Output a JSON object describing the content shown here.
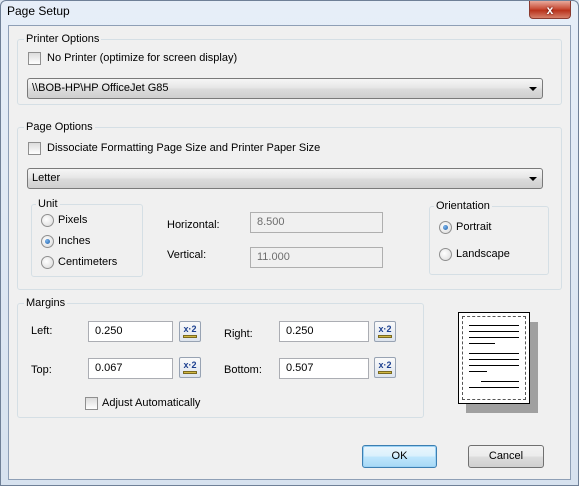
{
  "window": {
    "title": "Page Setup"
  },
  "printer_options": {
    "legend": "Printer Options",
    "no_printer_label": "No Printer (optimize for screen display)",
    "no_printer_checked": false,
    "printer_selected": "\\\\BOB-HP\\HP OfficeJet G85"
  },
  "page_options": {
    "legend": "Page Options",
    "dissociate_label": "Dissociate Formatting Page Size and Printer Paper Size",
    "dissociate_checked": false,
    "paper_selected": "Letter",
    "unit": {
      "legend": "Unit",
      "options": [
        "Pixels",
        "Inches",
        "Centimeters"
      ],
      "selected": "Inches"
    },
    "horizontal_label": "Horizontal:",
    "horizontal_value": "8.500",
    "vertical_label": "Vertical:",
    "vertical_value": "11.000",
    "orientation": {
      "legend": "Orientation",
      "options": [
        "Portrait",
        "Landscape"
      ],
      "selected": "Portrait"
    }
  },
  "margins": {
    "legend": "Margins",
    "left_label": "Left:",
    "left_value": "0.250",
    "right_label": "Right:",
    "right_value": "0.250",
    "top_label": "Top:",
    "top_value": "0.067",
    "bottom_label": "Bottom:",
    "bottom_value": "0.507",
    "calc_icon_text": "x·2",
    "adjust_label": "Adjust Automatically",
    "adjust_checked": false
  },
  "buttons": {
    "ok": "OK",
    "cancel": "Cancel"
  },
  "close_glyph": "x"
}
